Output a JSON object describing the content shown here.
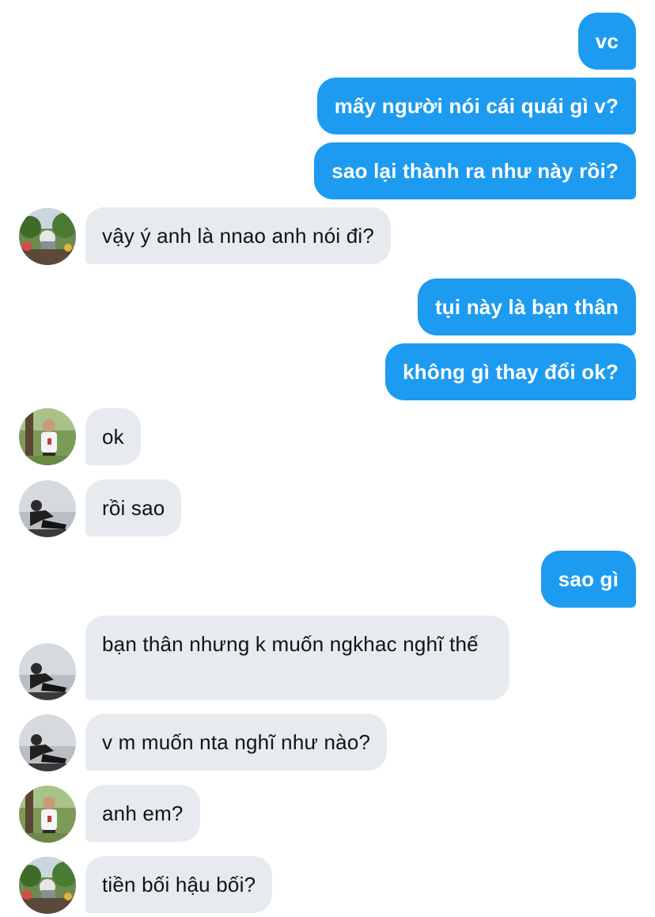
{
  "messages": [
    {
      "side": "sent",
      "text": "vc"
    },
    {
      "side": "sent",
      "text": "mấy người nói cái quái gì v?"
    },
    {
      "side": "sent",
      "text": "sao lại thành ra như này rồi?"
    },
    {
      "side": "received",
      "avatar": "avatar-garden-photo",
      "text": "vậy ý anh là nnao anh nói đi?"
    },
    {
      "side": "sent",
      "text": "tụi này là bạn thân"
    },
    {
      "side": "sent",
      "text": "không gì thay đổi ok?"
    },
    {
      "side": "received",
      "avatar": "avatar-person-white-shirt",
      "text": "ok"
    },
    {
      "side": "received",
      "avatar": "avatar-person-sitting",
      "text": "rồi sao"
    },
    {
      "side": "sent",
      "text": "sao gì"
    },
    {
      "side": "received",
      "avatar": "avatar-person-sitting",
      "text": "bạn thân nhưng k muốn ngkhac nghĩ thế"
    },
    {
      "side": "received",
      "avatar": "avatar-person-sitting",
      "text": "v m muốn nta nghĩ như nào?"
    },
    {
      "side": "received",
      "avatar": "avatar-person-white-shirt",
      "text": "anh em?"
    },
    {
      "side": "received",
      "avatar": "avatar-garden-photo",
      "text": "tiền bối hậu bối?"
    }
  ],
  "colors": {
    "sent_bubble": "#1d9bf0",
    "received_bubble": "#e7eaef",
    "sent_text": "#ffffff",
    "received_text": "#0f1419"
  }
}
